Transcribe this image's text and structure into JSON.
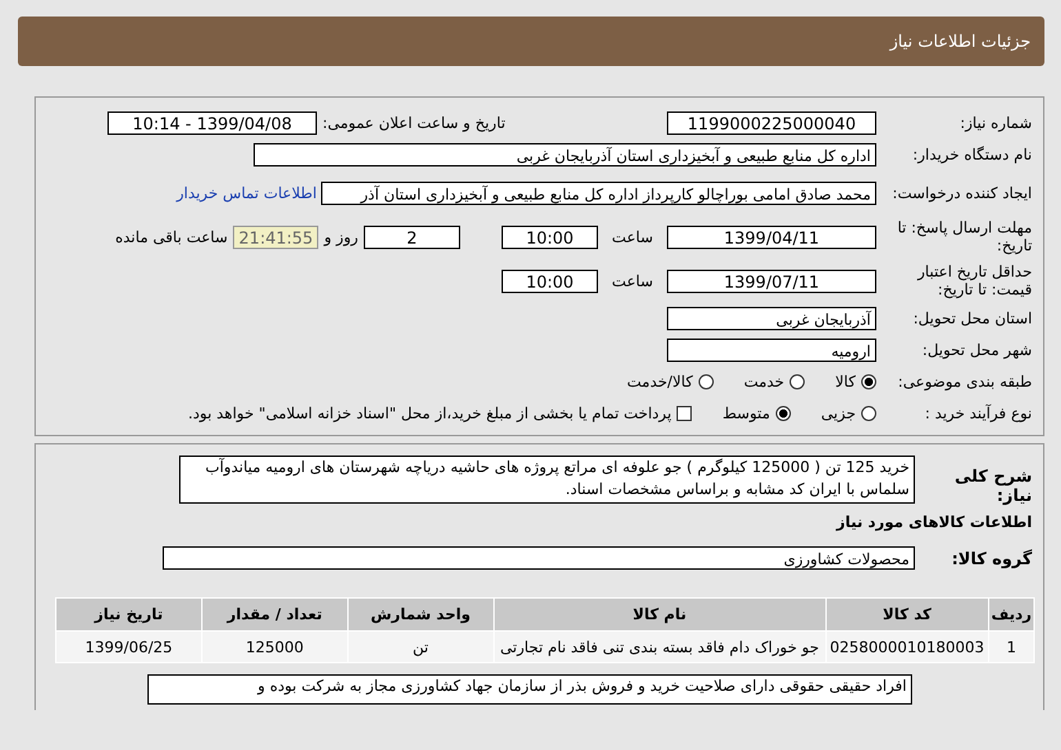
{
  "header": {
    "title": "جزئیات اطلاعات نیاز"
  },
  "need_number": {
    "label": "شماره نیاز:",
    "value": "1199000225000040"
  },
  "announce": {
    "label": "تاریخ و ساعت اعلان عمومی:",
    "value": "1399/04/08 - 10:14"
  },
  "buyer": {
    "label": "نام دستگاه خریدار:",
    "value": "اداره کل منابع طبیعی و آبخیزداری استان آذربایجان غربی"
  },
  "creator": {
    "label": "ایجاد کننده درخواست:",
    "value": "محمد صادق امامی بوراچالو کارپرداز اداره کل منابع طبیعی و آبخیزداری استان آذر",
    "link": "اطلاعات تماس خریدار"
  },
  "deadline": {
    "label": "مهلت ارسال پاسخ: تا تاریخ:",
    "date": "1399/04/11",
    "time_label": "ساعت",
    "time": "10:00",
    "days": "2",
    "days_label": "روز و",
    "countdown": "21:41:55",
    "remaining_label": "ساعت باقی مانده"
  },
  "validity": {
    "label": "حداقل تاریخ اعتبار قیمت: تا تاریخ:",
    "date": "1399/07/11",
    "time_label": "ساعت",
    "time": "10:00"
  },
  "province": {
    "label": "استان محل تحویل:",
    "value": "آذربایجان غربی"
  },
  "city": {
    "label": "شهر محل تحویل:",
    "value": "ارومیه"
  },
  "category": {
    "label": "طبقه بندی موضوعی:",
    "options": [
      {
        "label": "کالا",
        "selected": true
      },
      {
        "label": "خدمت",
        "selected": false
      },
      {
        "label": "کالا/خدمت",
        "selected": false
      }
    ]
  },
  "process": {
    "label": "نوع فرآیند خرید :",
    "options": [
      {
        "label": "جزیی",
        "selected": false
      },
      {
        "label": "متوسط",
        "selected": true
      }
    ],
    "treasury": {
      "checked": false,
      "label": "پرداخت تمام یا بخشی از مبلغ خرید،از محل \"اسناد خزانه اسلامی\" خواهد بود."
    }
  },
  "description": {
    "label": "شرح کلی نیاز:",
    "value": "خرید 125 تن ( 125000 کیلوگرم ) جو علوفه ای مراتع پروژه های حاشیه دریاچه شهرستان های ارومیه میاندوآب سلماس با ایران کد مشابه و براساس مشخصات اسناد."
  },
  "goods_heading": "اطلاعات کالاهای مورد نیاز",
  "goods_group": {
    "label": "گروه کالا:",
    "value": "محصولات کشاورزی"
  },
  "table": {
    "columns": [
      "ردیف",
      "کد کالا",
      "نام کالا",
      "واحد شمارش",
      "تعداد / مقدار",
      "تاریخ نیاز"
    ],
    "rows": [
      [
        "1",
        "0258000010180003",
        "جو خوراک دام فاقد بسته بندی تنی فاقد نام تجارتی",
        "تن",
        "125000",
        "1399/06/25"
      ]
    ]
  },
  "notes": "افراد حقیقی حقوقی دارای صلاحیت خرید و فروش بذر از سازمان جهاد کشاورزی مجاز به شرکت بوده و"
}
